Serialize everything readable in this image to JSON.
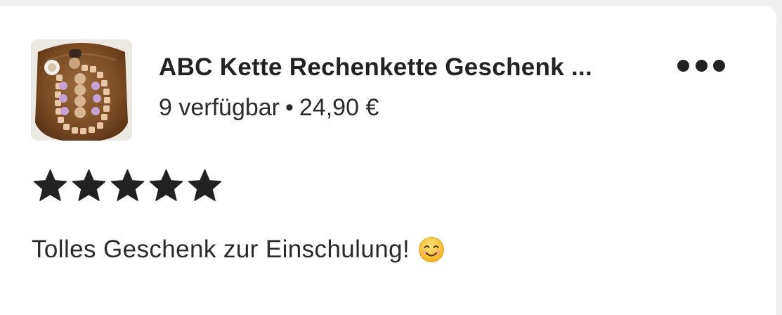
{
  "listing": {
    "image_alt": "ABC Kette Rechenkette Geschenk",
    "title": "ABC Kette Rechenkette Geschenk ...",
    "availability": "9 verfügbar",
    "separator": "•",
    "price": "24,90 €",
    "menu_icon": "more-horizontal-icon"
  },
  "review": {
    "rating": 5,
    "rating_max": 5,
    "text": "Tolles Geschenk zur Einschulung!",
    "emoji": "smiling-face-icon"
  },
  "colors": {
    "background": "#efefef",
    "card": "#ffffff",
    "text": "#222222",
    "star": "#222222"
  }
}
